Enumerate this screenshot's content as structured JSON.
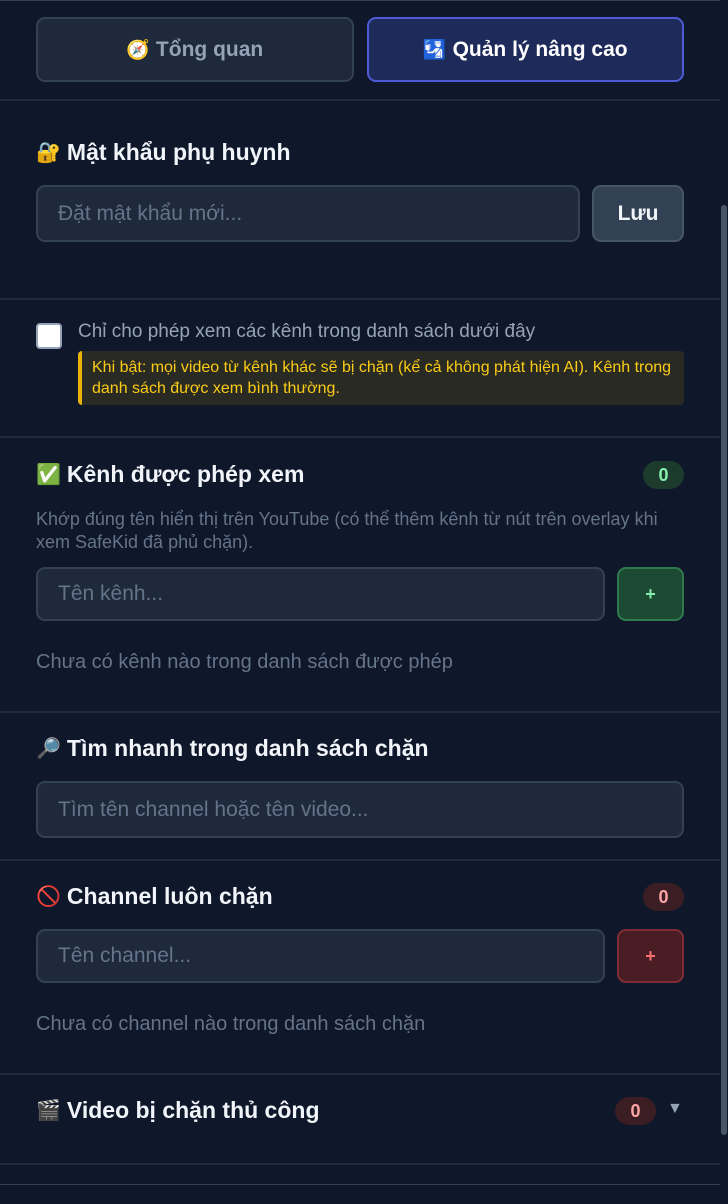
{
  "tabs": {
    "overview": {
      "icon": "🧭",
      "label": "Tổng quan"
    },
    "advanced": {
      "icon": "🛂",
      "label": "Quản lý nâng cao"
    }
  },
  "password": {
    "icon": "🔐",
    "title": "Mật khẩu phụ huynh",
    "placeholder": "Đặt mật khẩu mới...",
    "save_label": "Lưu"
  },
  "whitelist_only": {
    "label": "Chỉ cho phép xem các kênh trong danh sách dưới đây",
    "warning": "Khi bật: mọi video từ kênh khác sẽ bị chặn (kể cả không phát hiện AI). Kênh trong danh sách được xem bình thường."
  },
  "allowed_channels": {
    "icon": "✅",
    "title": "Kênh được phép xem",
    "count": "0",
    "description": "Khớp đúng tên hiển thị trên YouTube (có thể thêm kênh từ nút trên overlay khi xem SafeKid đã phủ chặn).",
    "placeholder": "Tên kênh...",
    "add_label": "+",
    "empty_text": "Chưa có kênh nào trong danh sách được phép"
  },
  "quick_search": {
    "icon": "🔎",
    "title": "Tìm nhanh trong danh sách chặn",
    "placeholder": "Tìm tên channel hoặc tên video..."
  },
  "blocked_channels": {
    "icon": "🚫",
    "title": "Channel luôn chặn",
    "count": "0",
    "placeholder": "Tên channel...",
    "add_label": "+",
    "empty_text": "Chưa có channel nào trong danh sách chặn"
  },
  "blocked_videos": {
    "icon": "🎬",
    "title": "Video bị chặn thủ công",
    "count": "0",
    "chevron": "▼"
  }
}
